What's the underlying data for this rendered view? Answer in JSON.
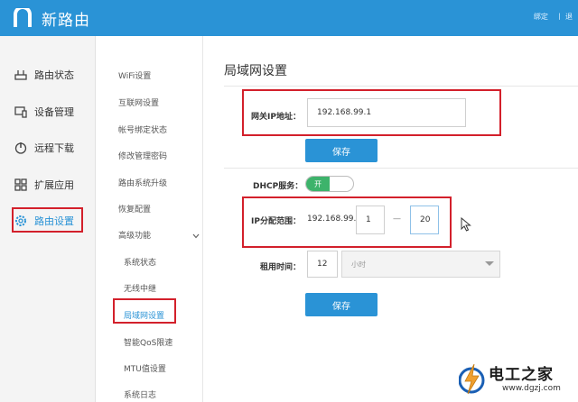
{
  "header": {
    "logo_text": "新路由",
    "links": [
      "绑定",
      "丨 退"
    ]
  },
  "sidebar": {
    "items": [
      {
        "label": "路由状态",
        "icon": "router-icon"
      },
      {
        "label": "设备管理",
        "icon": "device-icon"
      },
      {
        "label": "远程下载",
        "icon": "power-icon"
      },
      {
        "label": "扩展应用",
        "icon": "grid-icon"
      },
      {
        "label": "路由设置",
        "icon": "gear-icon",
        "active": true
      }
    ]
  },
  "submenu": {
    "items": [
      "WiFi设置",
      "互联网设置",
      "帐号绑定状态",
      "修改管理密码",
      "路由系统升级",
      "恢复配置",
      "高级功能"
    ],
    "children": [
      "系统状态",
      "无线中继",
      "局域网设置",
      "智能QoS限速",
      "MTU值设置",
      "系统日志"
    ]
  },
  "main": {
    "title": "局域网设置",
    "gateway": {
      "label": "网关IP地址：",
      "value": "192.168.99.1"
    },
    "save_label": "保存",
    "dhcp": {
      "label": "DHCP服务：",
      "toggle": "开"
    },
    "ip_range": {
      "label": "IP分配范围：",
      "prefix": "192.168.99.",
      "start": "1",
      "dash": "—",
      "end": "20"
    },
    "lease": {
      "label": "租用时间：",
      "value": "12",
      "unit": "小时"
    }
  },
  "watermark": {
    "text": "电工之家",
    "url": "www.dgzj.com"
  },
  "colors": {
    "header": "#2a93d6",
    "accent": "#2a93d6",
    "toggle_on": "#3db36b",
    "highlight": "#d3202b"
  }
}
